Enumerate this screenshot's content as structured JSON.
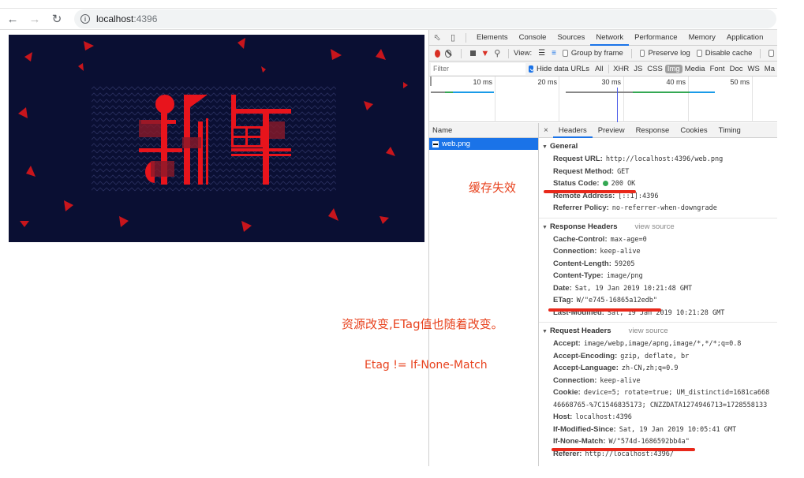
{
  "browser": {
    "url_host": "localhost",
    "url_port": ":4396",
    "back_icon": "arrow-left-icon",
    "forward_icon": "arrow-right-icon",
    "reload_icon": "reload-icon",
    "info_icon": "info-icon"
  },
  "page": {
    "banner_text": "新年",
    "banner_colors": {
      "background": "#0a0f33",
      "accent": "#e8141c"
    }
  },
  "devtools": {
    "main_tabs": [
      "Elements",
      "Console",
      "Sources",
      "Network",
      "Performance",
      "Memory",
      "Application"
    ],
    "active_tab": "Network",
    "toolbar": {
      "view_label": "View:",
      "group_by_frame": "Group by frame",
      "preserve_log": "Preserve log",
      "disable_cache": "Disable cache"
    },
    "filter": {
      "placeholder": "Filter",
      "hide_data_urls": "Hide data URLs",
      "types": [
        "All",
        "XHR",
        "JS",
        "CSS",
        "Img",
        "Media",
        "Font",
        "Doc",
        "WS",
        "Ma"
      ],
      "active_type": "Img"
    },
    "overview": {
      "ticks": [
        "10 ms",
        "20 ms",
        "30 ms",
        "40 ms",
        "50 ms"
      ]
    },
    "request_list": {
      "column_name": "Name",
      "items": [
        {
          "name": "web.png",
          "selected": true
        }
      ]
    },
    "detail_tabs": [
      "Headers",
      "Preview",
      "Response",
      "Cookies",
      "Timing"
    ],
    "active_detail_tab": "Headers",
    "general": {
      "title": "General",
      "rows": [
        {
          "key": "Request URL:",
          "value": "http://localhost:4396/web.png"
        },
        {
          "key": "Request Method:",
          "value": "GET"
        },
        {
          "key": "Status Code:",
          "value": "200 OK"
        },
        {
          "key": "Remote Address:",
          "value": "[::1]:4396"
        },
        {
          "key": "Referrer Policy:",
          "value": "no-referrer-when-downgrade"
        }
      ]
    },
    "response_headers": {
      "title": "Response Headers",
      "view_source": "view source",
      "rows": [
        {
          "key": "Cache-Control:",
          "value": "max-age=0"
        },
        {
          "key": "Connection:",
          "value": "keep-alive"
        },
        {
          "key": "Content-Length:",
          "value": "59205"
        },
        {
          "key": "Content-Type:",
          "value": "image/png"
        },
        {
          "key": "Date:",
          "value": "Sat, 19 Jan 2019 10:21:48 GMT"
        },
        {
          "key": "ETag:",
          "value": "W/\"e745-16865a12edb\""
        },
        {
          "key": "Last-Modified:",
          "value": "Sat, 19 Jan 2019 10:21:28 GMT"
        }
      ]
    },
    "request_headers": {
      "title": "Request Headers",
      "view_source": "view source",
      "rows": [
        {
          "key": "Accept:",
          "value": "image/webp,image/apng,image/*,*/*;q=0.8"
        },
        {
          "key": "Accept-Encoding:",
          "value": "gzip, deflate, br"
        },
        {
          "key": "Accept-Language:",
          "value": "zh-CN,zh;q=0.9"
        },
        {
          "key": "Connection:",
          "value": "keep-alive"
        },
        {
          "key": "Cookie:",
          "value": "device=5; rotate=true; UM_distinctid=1681ca668"
        },
        {
          "key": "",
          "value": "46668765-%7C1546835173; CNZZDATA1274946713=1728558133"
        },
        {
          "key": "Host:",
          "value": "localhost:4396"
        },
        {
          "key": "If-Modified-Since:",
          "value": "Sat, 19 Jan 2019 10:05:41 GMT"
        },
        {
          "key": "If-None-Match:",
          "value": "W/\"574d-1686592bb4a\""
        },
        {
          "key": "Referer:",
          "value": "http://localhost:4396/"
        }
      ]
    }
  },
  "annotations": {
    "cache_invalid": "缓存失效",
    "resource_changed": "资源改变,ETag值也随着改变。",
    "etag_neq": "Etag != If-None-Match",
    "color": "#e8431f"
  }
}
